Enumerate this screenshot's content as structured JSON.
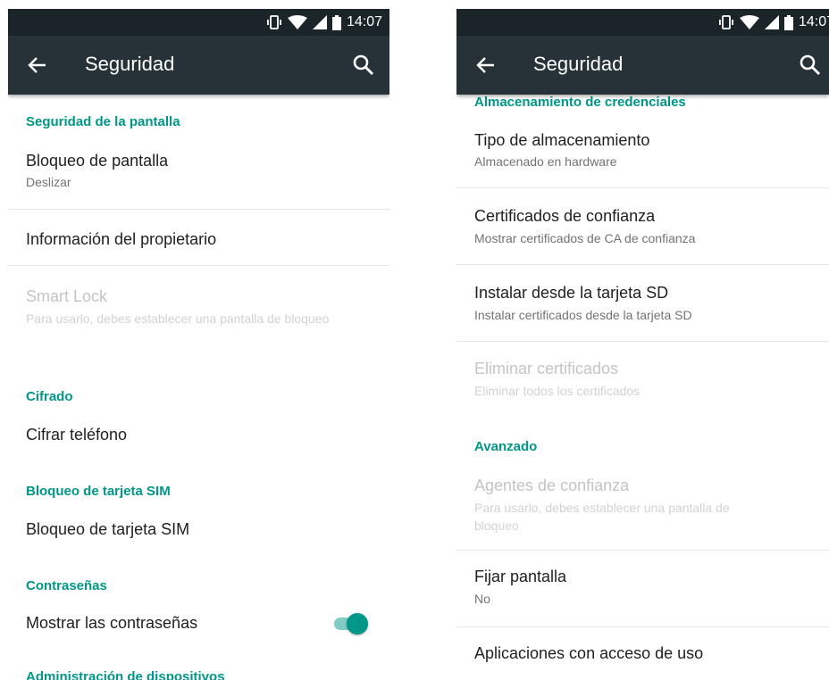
{
  "status_bar": {
    "time": "14:07"
  },
  "app_bar": {
    "title": "Seguridad"
  },
  "left_screen": {
    "sections": {
      "pantalla": "Seguridad de la pantalla",
      "cifrado": "Cifrado",
      "sim": "Bloqueo de tarjeta SIM",
      "contrasenas": "Contraseñas",
      "admin": "Administración de dispositivos"
    },
    "items": {
      "bloqueo_pantalla": {
        "title": "Bloqueo de pantalla",
        "summary": "Deslizar"
      },
      "info_propietario": {
        "title": "Información del propietario"
      },
      "smart_lock": {
        "title": "Smart Lock",
        "summary": "Para usarlo, debes establecer una pantalla de bloqueo"
      },
      "cifrar_telefono": {
        "title": "Cifrar teléfono"
      },
      "bloqueo_sim": {
        "title": "Bloqueo de tarjeta SIM"
      },
      "mostrar_contrasenas": {
        "title": "Mostrar las contraseñas",
        "toggle_on": true
      }
    }
  },
  "right_screen": {
    "sections": {
      "credenciales": "Almacenamiento de credenciales",
      "avanzado": "Avanzado"
    },
    "items": {
      "tipo_almacenamiento": {
        "title": "Tipo de almacenamiento",
        "summary": "Almacenado en hardware"
      },
      "certificados_confianza": {
        "title": "Certificados de confianza",
        "summary": "Mostrar certificados de CA de confianza"
      },
      "instalar_sd": {
        "title": "Instalar desde la tarjeta SD",
        "summary": "Instalar certificados desde la tarjeta SD"
      },
      "eliminar_certificados": {
        "title": "Eliminar certificados",
        "summary": "Eliminar todos los certificados"
      },
      "agentes_confianza": {
        "title": "Agentes de confianza",
        "summary": "Para usarlo, debes establecer una pantalla de bloqueo"
      },
      "fijar_pantalla": {
        "title": "Fijar pantalla",
        "summary": "No"
      },
      "acceso_uso": {
        "title": "Aplicaciones con acceso de uso"
      }
    }
  },
  "colors": {
    "status_bar": "#1b2529",
    "app_bar": "#263238",
    "accent": "#009688",
    "disabled_text": "#c4c4c4"
  },
  "icons": {
    "back": "arrow-back-icon",
    "search": "search-icon",
    "vibrate": "vibrate-icon",
    "wifi": "wifi-icon",
    "signal": "signal-icon",
    "battery": "battery-icon"
  }
}
